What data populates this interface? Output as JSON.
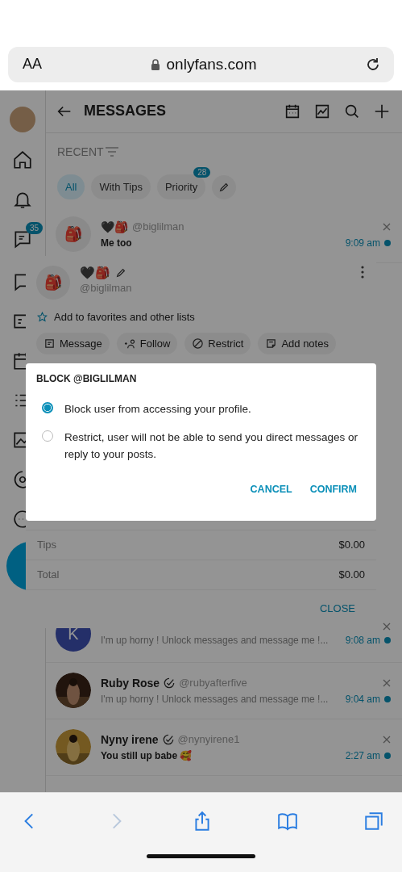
{
  "browser": {
    "text_size_button": "AA",
    "url": "onlyfans.com"
  },
  "sidebar": {
    "messages_badge": "35"
  },
  "header": {
    "title": "MESSAGES"
  },
  "section": {
    "title": "RECENT"
  },
  "filters": [
    {
      "label": "All",
      "selected": true
    },
    {
      "label": "With Tips",
      "selected": false
    },
    {
      "label": "Priority",
      "selected": false,
      "badge": "28"
    }
  ],
  "conversations": [
    {
      "name": "🖤🎒",
      "handle": "@biglilman",
      "message": "Me too",
      "time": "9:09 am",
      "unread": true,
      "avatar": "🎒"
    },
    {
      "avatar_letter": "K",
      "message": "I'm up horny ! Unlock messages and message me !...",
      "time": "9:08 am",
      "unread": false
    },
    {
      "name": "Ruby Rose",
      "handle": "@rubyafterfive",
      "verified": true,
      "message": "I'm up horny ! Unlock messages and message me !...",
      "time": "9:04 am",
      "unread": false,
      "photo": true
    },
    {
      "name": "Nyny irene",
      "handle": "@nynyirene1",
      "verified": true,
      "message": "You still up babe 🥰",
      "time": "2:27 am",
      "unread": true,
      "photo": true
    }
  ],
  "profile_card": {
    "name": "🖤🎒",
    "avatar": "🎒",
    "handle": "@biglilman",
    "favorites": "Add to favorites and other lists",
    "actions": [
      {
        "kind": "message",
        "label": "Message"
      },
      {
        "kind": "follow",
        "label": "Follow"
      },
      {
        "kind": "restrict",
        "label": "Restrict"
      },
      {
        "kind": "notes",
        "label": "Add notes"
      }
    ],
    "rows": [
      {
        "label": "Tips",
        "value": "$0.00"
      },
      {
        "label": "Total",
        "value": "$0.00"
      }
    ],
    "close": "CLOSE"
  },
  "dialog": {
    "title": "BLOCK @BIGLILMAN",
    "options": [
      {
        "label": "Block user from accessing your profile.",
        "selected": true
      },
      {
        "label": "Restrict, user will not be able to send you direct messages or reply to your posts.",
        "selected": false
      }
    ],
    "buttons": [
      "CANCEL",
      "CONFIRM"
    ]
  }
}
